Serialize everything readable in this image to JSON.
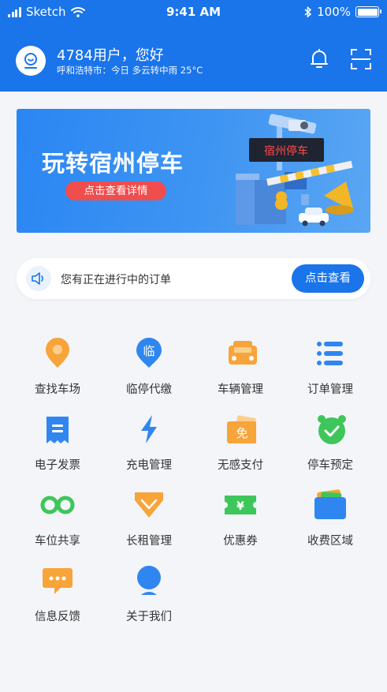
{
  "status_bar": {
    "carrier": "Sketch",
    "time": "9:41 AM",
    "battery": "100%"
  },
  "header": {
    "greeting": "4784用户，您好",
    "weather": "呼和浩特市：今日 多云转中雨 25°C"
  },
  "banner": {
    "title": "玩转宿州停车",
    "button_label": "点击查看详情",
    "sign_text": "宿州停车"
  },
  "notice": {
    "text": "您有正在进行中的订单",
    "button_label": "点击查看"
  },
  "menu": [
    {
      "label": "查找车场",
      "icon": "location-pin-icon"
    },
    {
      "label": "临停代缴",
      "icon": "temp-parking-icon"
    },
    {
      "label": "车辆管理",
      "icon": "car-icon"
    },
    {
      "label": "订单管理",
      "icon": "list-icon"
    },
    {
      "label": "电子发票",
      "icon": "invoice-icon"
    },
    {
      "label": "充电管理",
      "icon": "lightning-icon"
    },
    {
      "label": "无感支付",
      "icon": "free-ticket-icon"
    },
    {
      "label": "停车预定",
      "icon": "alarm-clock-icon"
    },
    {
      "label": "车位共享",
      "icon": "infinity-icon"
    },
    {
      "label": "长租管理",
      "icon": "diamond-icon"
    },
    {
      "label": "优惠券",
      "icon": "coupon-icon"
    },
    {
      "label": "收费区域",
      "icon": "wallet-icon"
    },
    {
      "label": "信息反馈",
      "icon": "chat-bubble-icon"
    },
    {
      "label": "关于我们",
      "icon": "person-pin-icon"
    }
  ],
  "icon_glyphs": {
    "temp_parking": "临",
    "free": "免",
    "coupon": "¥"
  },
  "colors": {
    "primary": "#1a74ea",
    "accent_red": "#f04d4d",
    "orange": "#f7a43a",
    "green": "#3fc65a"
  }
}
